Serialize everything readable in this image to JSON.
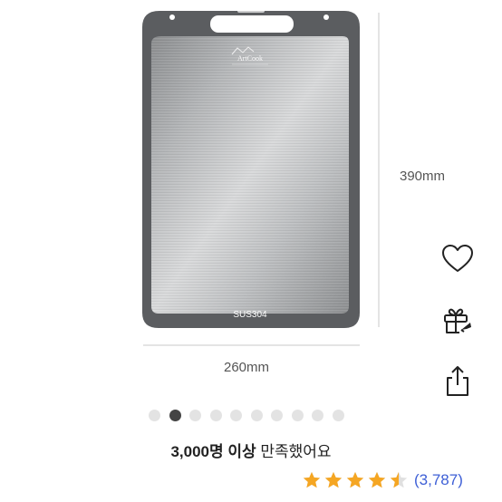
{
  "product": {
    "brand_mark": "ArtCook",
    "plate_label": "SUS304",
    "height_dimension": "390mm",
    "width_dimension": "260mm"
  },
  "actions": [
    {
      "name": "wishlist-button",
      "icon": "heart-icon"
    },
    {
      "name": "gift-button",
      "icon": "gift-icon"
    },
    {
      "name": "share-button",
      "icon": "share-icon"
    }
  ],
  "carousel": {
    "total": 10,
    "active_index": 1
  },
  "satisfaction": {
    "highlight": "3,000명 이상",
    "rest": "만족했어요"
  },
  "rating": {
    "value": 4.5,
    "max": 5,
    "review_count": "(3,787)"
  },
  "colors": {
    "star": "#f5a623",
    "star_empty": "#e0e0e0",
    "review_count": "#3d5fd6",
    "board_frame": "#5b5d60",
    "active_dot": "#444444",
    "inactive_dot": "#e3e3e3"
  }
}
